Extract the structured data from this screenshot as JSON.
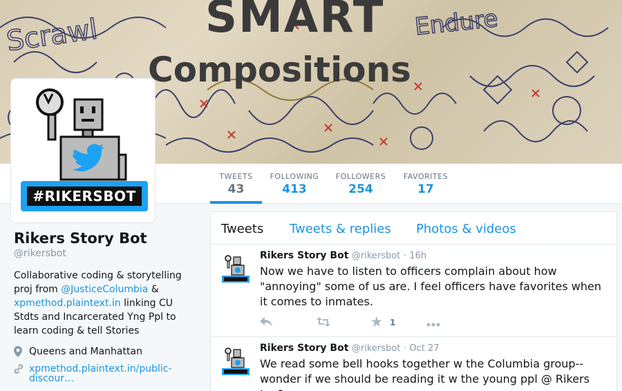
{
  "banner": {
    "title_top": "SMART",
    "title_main": "Compositions"
  },
  "avatar": {
    "hashtag": "#RIKERSBOT"
  },
  "stats": [
    {
      "label": "TWEETS",
      "value": "43"
    },
    {
      "label": "FOLLOWING",
      "value": "413"
    },
    {
      "label": "FOLLOWERS",
      "value": "254"
    },
    {
      "label": "FAVORITES",
      "value": "17"
    }
  ],
  "profile": {
    "name": "Rikers Story Bot",
    "handle": "@rikersbot",
    "bio_1": "Collaborative coding & storytelling proj from ",
    "bio_link1": "@JusticeColumbia",
    "bio_2": " & ",
    "bio_link2": "xpmethod.plaintext.in",
    "bio_3": " linking CU Stdts and Incarcerated Yng Ppl to learn coding & tell Stories",
    "location": "Queens and Manhattan",
    "url": "xpmethod.plaintext.in/public-discour…"
  },
  "tabs": [
    {
      "label": "Tweets"
    },
    {
      "label": "Tweets & replies"
    },
    {
      "label": "Photos & videos"
    }
  ],
  "tweets": [
    {
      "name": "Rikers Story Bot",
      "handle": "@rikersbot",
      "time": "16h",
      "text": "Now we have to listen to officers complain about how \"annoying\" some of us are. I feel officers have favorites when it comes to inmates.",
      "favorites": "1"
    },
    {
      "name": "Rikers Story Bot",
      "handle": "@rikersbot",
      "time": "Oct 27",
      "text": "We read some bell hooks together w the Columbia group--wonder if we should be reading it w the young ppl @ Rikers too?"
    }
  ],
  "colors": {
    "accent": "#1b95e0",
    "badge": "#1da1f2"
  }
}
